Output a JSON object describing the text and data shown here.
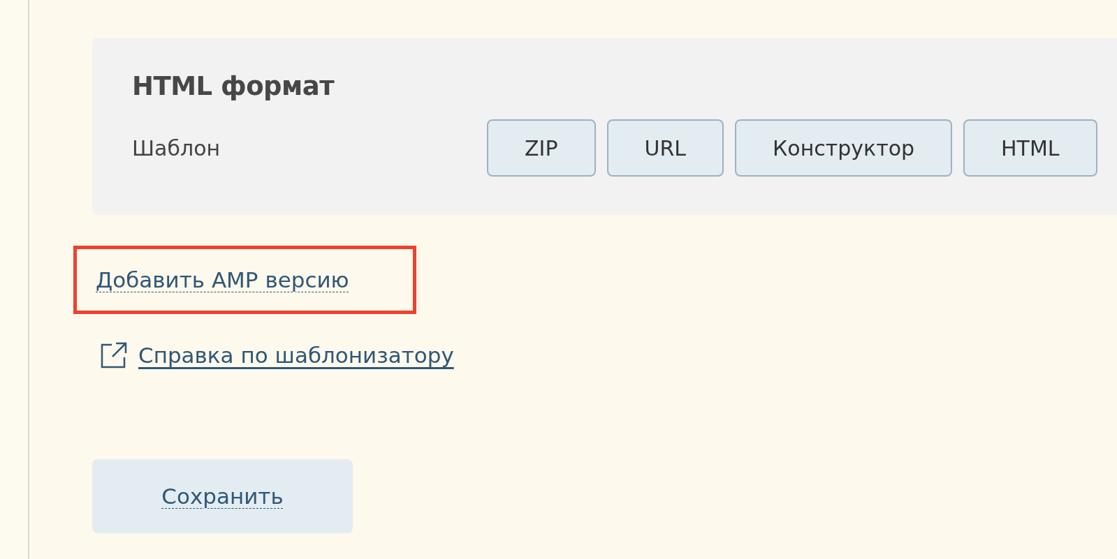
{
  "format_card": {
    "title": "HTML формат",
    "label": "Шаблон",
    "options": [
      {
        "label": "ZIP"
      },
      {
        "label": "URL"
      },
      {
        "label": "Конструктор"
      },
      {
        "label": "HTML"
      }
    ]
  },
  "amp_link": {
    "label": "Добавить AMP версию",
    "highlighted": true
  },
  "help_link": {
    "label": "Справка по шаблонизатору"
  },
  "save_button": {
    "label": "Сохранить"
  }
}
